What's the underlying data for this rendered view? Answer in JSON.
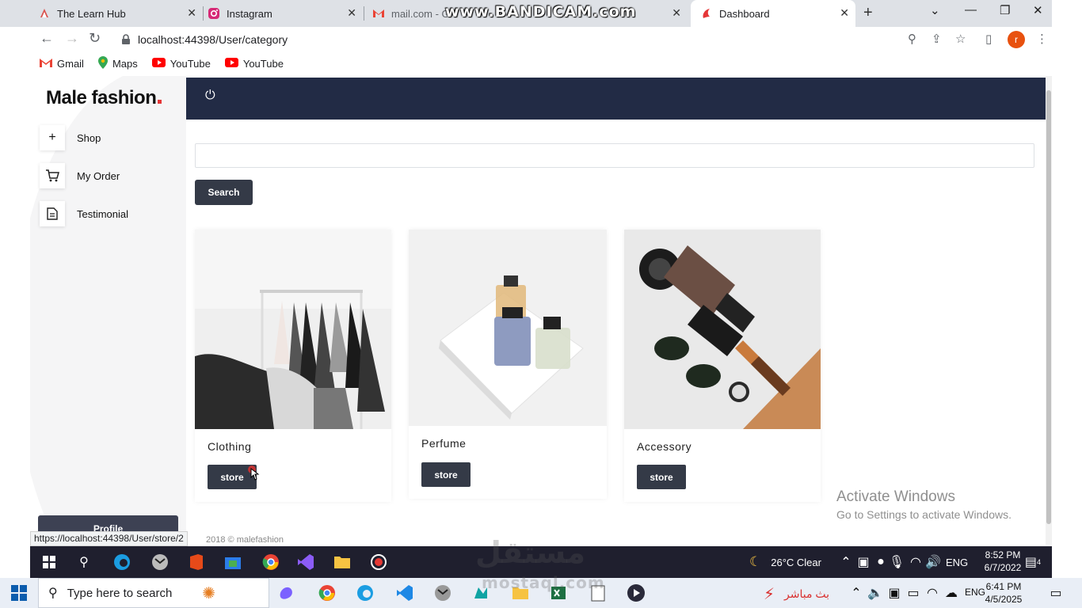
{
  "browser": {
    "tabs": [
      {
        "title": "The Learn Hub",
        "icon": "learnhub-icon"
      },
      {
        "title": "Instagram",
        "icon": "instagram-icon"
      },
      {
        "title": "mail.com - G",
        "icon": "gmail-icon"
      },
      {
        "title": "Dashboard",
        "icon": "dashboard-icon",
        "active": true
      }
    ],
    "recorder_overlay": "www.BANDICAM.com",
    "url": "localhost:44398/User/category",
    "bookmarks": [
      "Gmail",
      "Maps",
      "YouTube",
      "YouTube"
    ],
    "avatar_letter": "r",
    "status_url": "https://localhost:44398/User/store/2"
  },
  "sidebar": {
    "logo": "Male fashion",
    "items": [
      {
        "label": "Shop",
        "icon": "plus-icon"
      },
      {
        "label": "My Order",
        "icon": "cart-icon"
      },
      {
        "label": "Testimonial",
        "icon": "document-icon"
      }
    ],
    "profile_label": "Profile"
  },
  "search": {
    "placeholder": "",
    "button_label": "Search"
  },
  "categories": [
    {
      "name": "Clothing",
      "button": "store"
    },
    {
      "name": "Perfume",
      "button": "store"
    },
    {
      "name": "Accessory",
      "button": "store"
    }
  ],
  "footer": "2018 © malefashion",
  "activation": {
    "title": "Activate Windows",
    "subtitle": "Go to Settings to activate Windows."
  },
  "taskbar_inner": {
    "weather": "26°C  Clear",
    "lang": "ENG",
    "time": "8:52 PM",
    "date": "6/7/2022",
    "notifications": "4"
  },
  "taskbar_outer": {
    "search_placeholder": "Type here to search",
    "live_label": "بث مباشر",
    "lang": "ENG",
    "time": "6:41 PM",
    "date": "4/5/2025"
  },
  "watermark": {
    "arabic": "مستقل",
    "latin": "mostaql.com"
  },
  "colors": {
    "accent": "#e53637",
    "topbar": "#222b45",
    "button": "#343a47"
  }
}
